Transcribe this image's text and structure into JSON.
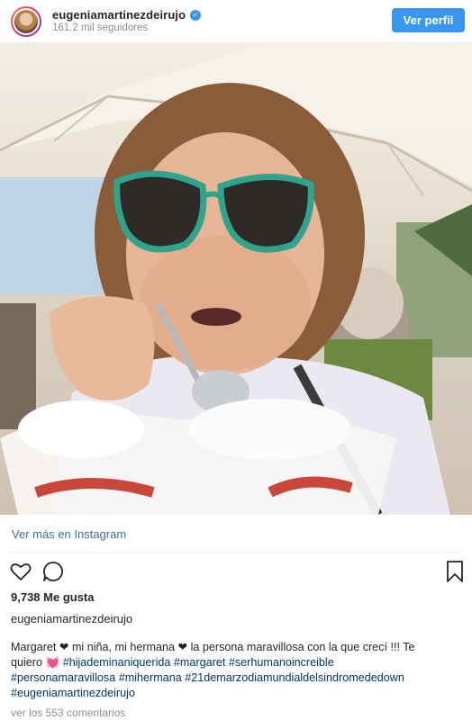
{
  "header": {
    "username": "eugeniamartinezdeirujo",
    "verified_icon": "verified-badge-icon",
    "followers": "161.2 mil seguidores",
    "follow_button": "Ver perfil"
  },
  "photo": {
    "alt": ""
  },
  "links": {
    "view_more": "Ver más en Instagram"
  },
  "actions": {
    "like_icon": "heart-icon",
    "comment_icon": "comment-icon",
    "save_icon": "bookmark-icon"
  },
  "stats": {
    "likes": "9,738 Me gusta"
  },
  "post": {
    "author": "eugeniamartinezdeirujo",
    "caption_line1": "Margaret ❤ mi niña, mi hermana ❤ la persona maravillosa con la que crecí !!! Te",
    "caption_line2_text": "quiero 💓 ",
    "hashtags": [
      "#hijademinaniquerida",
      "#margaret",
      "#serhumanoincreible",
      "#personamaravillosa",
      "#mihermana",
      "#21demarzodiamundialdelsindromededown",
      "#eugeniamartinezdeirujo"
    ],
    "comments_link": "ver los 553 comentarios"
  },
  "colors": {
    "accent": "#3897f0",
    "link": "#003569",
    "muted": "#8e8e8e"
  }
}
